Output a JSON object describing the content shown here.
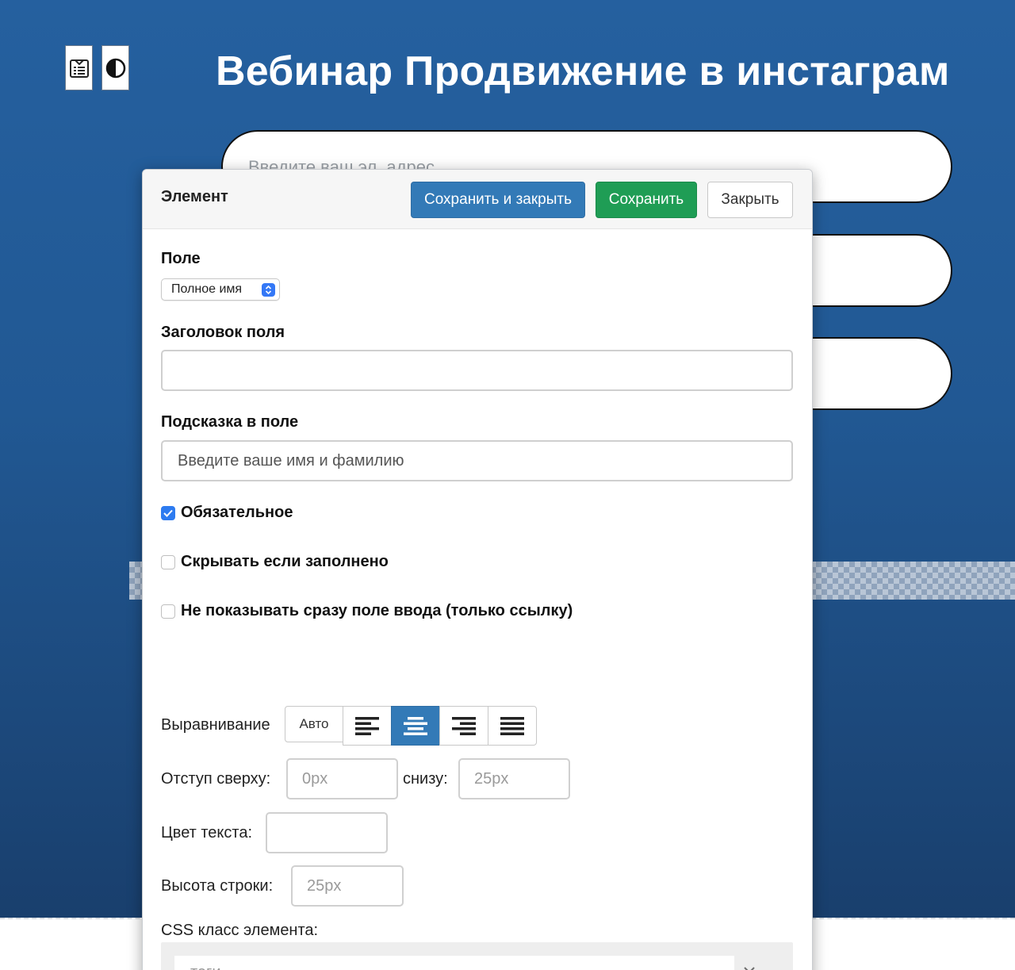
{
  "page": {
    "title": "Вебинар Продвижение в инстаграм",
    "email_placeholder": "Введите ваш эл. адрес",
    "tools": [
      "form-icon",
      "contrast-icon"
    ]
  },
  "modal": {
    "title": "Элемент",
    "buttons": {
      "save_close": "Сохранить и закрыть",
      "save": "Сохранить",
      "close": "Закрыть"
    },
    "field": {
      "label": "Поле",
      "selected": "Полное имя"
    },
    "field_title": {
      "label": "Заголовок поля",
      "value": ""
    },
    "field_hint": {
      "label": "Подсказка в поле",
      "value": "Введите ваше имя и фамилию"
    },
    "checkboxes": [
      {
        "label": "Обязательное",
        "checked": true
      },
      {
        "label": "Скрывать если заполнено",
        "checked": false
      },
      {
        "label": "Не показывать сразу поле ввода (только ссылку)",
        "checked": false
      }
    ],
    "alignment": {
      "label": "Выравнивание",
      "auto_label": "Авто",
      "options": [
        "align-left-icon",
        "align-center-icon",
        "align-right-icon",
        "align-justify-icon"
      ],
      "selected": "align-center-icon"
    },
    "margin": {
      "top_label": "Отступ сверху:",
      "top_placeholder": "0px",
      "bottom_label": "снизу:",
      "bottom_placeholder": "25px"
    },
    "text_color": {
      "label": "Цвет текста:",
      "value": ""
    },
    "line_height": {
      "label": "Высота строки:",
      "placeholder": "25px"
    },
    "css_class": {
      "label": "CSS класс элемента:",
      "placeholder": "теги",
      "clear_icon": "close-icon"
    },
    "colors": {
      "primary": "#337ab7",
      "success": "#1f9d55",
      "checkbox": "#2d7bf0",
      "page_bg": "#215893"
    }
  }
}
